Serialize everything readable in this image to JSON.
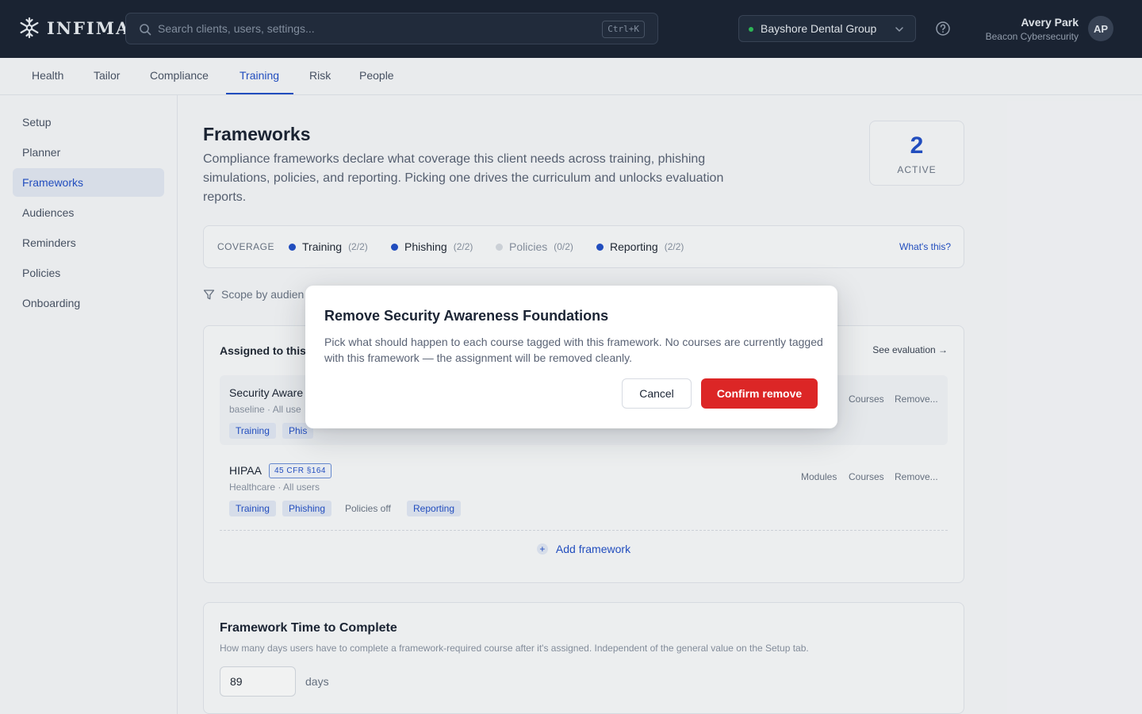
{
  "header": {
    "logo_text": "INFIMA",
    "search_placeholder": "Search clients, users, settings...",
    "search_shortcut": "Ctrl+K",
    "client_name": "Bayshore Dental Group",
    "user_name": "Avery Park",
    "user_org": "Beacon Cybersecurity",
    "user_initials": "AP"
  },
  "tabs": [
    {
      "label": "Health"
    },
    {
      "label": "Tailor"
    },
    {
      "label": "Compliance"
    },
    {
      "label": "Training",
      "active": true
    },
    {
      "label": "Risk"
    },
    {
      "label": "People"
    }
  ],
  "sidebar": {
    "items": [
      {
        "label": "Setup"
      },
      {
        "label": "Planner"
      },
      {
        "label": "Frameworks",
        "active": true
      },
      {
        "label": "Audiences"
      },
      {
        "label": "Reminders"
      },
      {
        "label": "Policies"
      },
      {
        "label": "Onboarding"
      }
    ]
  },
  "main": {
    "title": "Frameworks",
    "description": "Compliance frameworks declare what coverage this client needs across training, phishing simulations, policies, and reporting. Picking one drives the curriculum and unlocks evaluation reports.",
    "active_count": "2",
    "active_label": "ACTIVE",
    "coverage": {
      "label": "COVERAGE",
      "items": [
        {
          "name": "Training",
          "count": "(2/2)"
        },
        {
          "name": "Phishing",
          "count": "(2/2)"
        },
        {
          "name": "Policies",
          "count": "(0/2)"
        },
        {
          "name": "Reporting",
          "count": "(2/2)"
        }
      ],
      "whats_this": "What's this?"
    },
    "scope_text": "Scope by audien",
    "assigned": {
      "title": "Assigned to this",
      "see_evaluation": "See evaluation →",
      "frameworks": [
        {
          "name": "Security Aware",
          "sub": "baseline · All use",
          "chips": [
            "Training",
            "Phis"
          ],
          "actions": [
            "Courses",
            "Remove..."
          ]
        },
        {
          "name": "HIPAA",
          "citation": "45 CFR §164",
          "sub": "Healthcare · All users",
          "chips": [
            "Training",
            "Phishing",
            "Policies off",
            "Reporting"
          ],
          "actions": [
            "Modules",
            "Courses",
            "Remove..."
          ]
        }
      ],
      "add_label": "Add framework"
    },
    "time_to_complete": {
      "title": "Framework Time to Complete",
      "description": "How many days users have to complete a framework-required course after it's assigned. Independent of the general value on the Setup tab.",
      "value": "89",
      "unit": "days"
    }
  },
  "modal": {
    "title": "Remove Security Awareness Foundations",
    "body": "Pick what should happen to each course tagged with this framework. No courses are currently tagged with this framework — the assignment will be removed cleanly.",
    "cancel_label": "Cancel",
    "confirm_label": "Confirm remove"
  }
}
